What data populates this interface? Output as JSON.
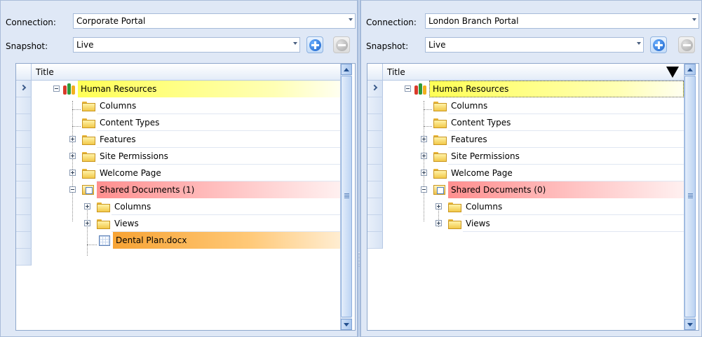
{
  "left": {
    "connection_label": "Connection:",
    "connection_value": "Corporate Portal",
    "snapshot_label": "Snapshot:",
    "snapshot_value": "Live",
    "column_header": "Title",
    "rows": [
      "Human Resources",
      "Columns",
      "Content Types",
      "Features",
      "Site Permissions",
      "Welcome Page",
      "Shared Documents (1)",
      "Columns",
      "Views",
      "Dental Plan.docx"
    ]
  },
  "right": {
    "connection_label": "Connection:",
    "connection_value": "London Branch Portal",
    "snapshot_label": "Snapshot:",
    "snapshot_value": "Live",
    "column_header": "Title",
    "rows": [
      "Human Resources",
      "Columns",
      "Content Types",
      "Features",
      "Site Permissions",
      "Welcome Page",
      "Shared Documents (0)",
      "Columns",
      "Views"
    ]
  },
  "colors": {
    "match_highlight": "#ffff55",
    "difference_highlight": "#ff8f8f",
    "item_only_highlight": "#f7a334",
    "panel_background": "#dfe8f6"
  },
  "icons": {
    "site": "site-icon",
    "folder": "folder-icon",
    "document_library": "document-library-icon",
    "file": "document-icon",
    "add": "add-snapshot-icon",
    "remove": "remove-snapshot-icon"
  }
}
